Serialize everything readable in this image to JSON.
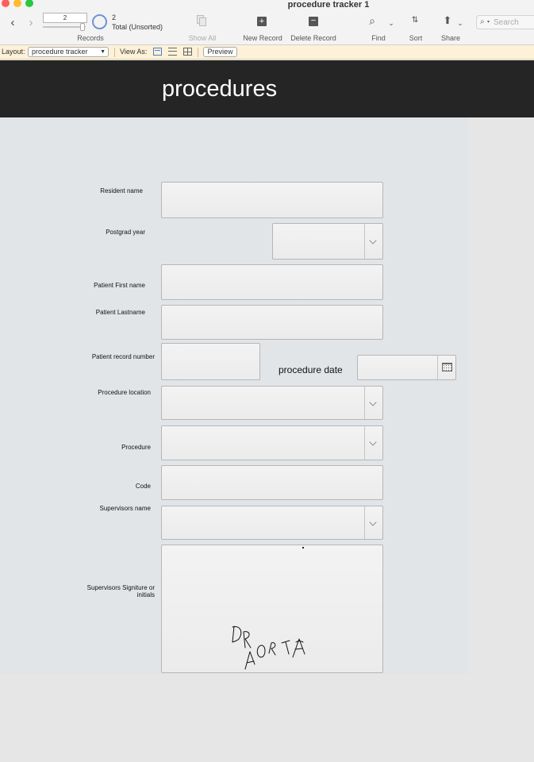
{
  "window": {
    "title": "procedure tracker 1"
  },
  "toolbar": {
    "current_record": "2",
    "record_count": "2",
    "record_total": "Total (Unsorted)",
    "records_label": "Records",
    "show_all_label": "Show All",
    "new_record_label": "New Record",
    "delete_record_label": "Delete Record",
    "find_label": "Find",
    "sort_label": "Sort",
    "share_label": "Share",
    "search_placeholder": "Search"
  },
  "layout_bar": {
    "layout_label": "Layout:",
    "layout_value": "procedure tracker",
    "view_as_label": "View As:",
    "preview_label": "Preview"
  },
  "header": {
    "title": "procedures"
  },
  "form": {
    "resident_name_label": "Resident name",
    "postgrad_year_label": "Postgrad year",
    "patient_first_name_label": "Patient First name",
    "patient_lastname_label": "Patient Lastname",
    "patient_record_number_label": "Patient record number",
    "procedure_date_label": "procedure date",
    "procedure_location_label": "Procedure location",
    "procedure_label": "Procedure",
    "code_label": "Code",
    "supervisors_name_label": "Supervisors name",
    "signature_label": "Supervisors Signiture or initials"
  },
  "icons": {
    "back": "chevron-left-icon",
    "forward": "chevron-right-icon",
    "find": "magnifier-icon",
    "sort": "sort-icon",
    "share": "share-icon",
    "calendar": "calendar-icon"
  },
  "colors": {
    "header_background": "#252525",
    "layout_bar_background": "#fdf1d8",
    "form_background": "#e2e5e8"
  }
}
